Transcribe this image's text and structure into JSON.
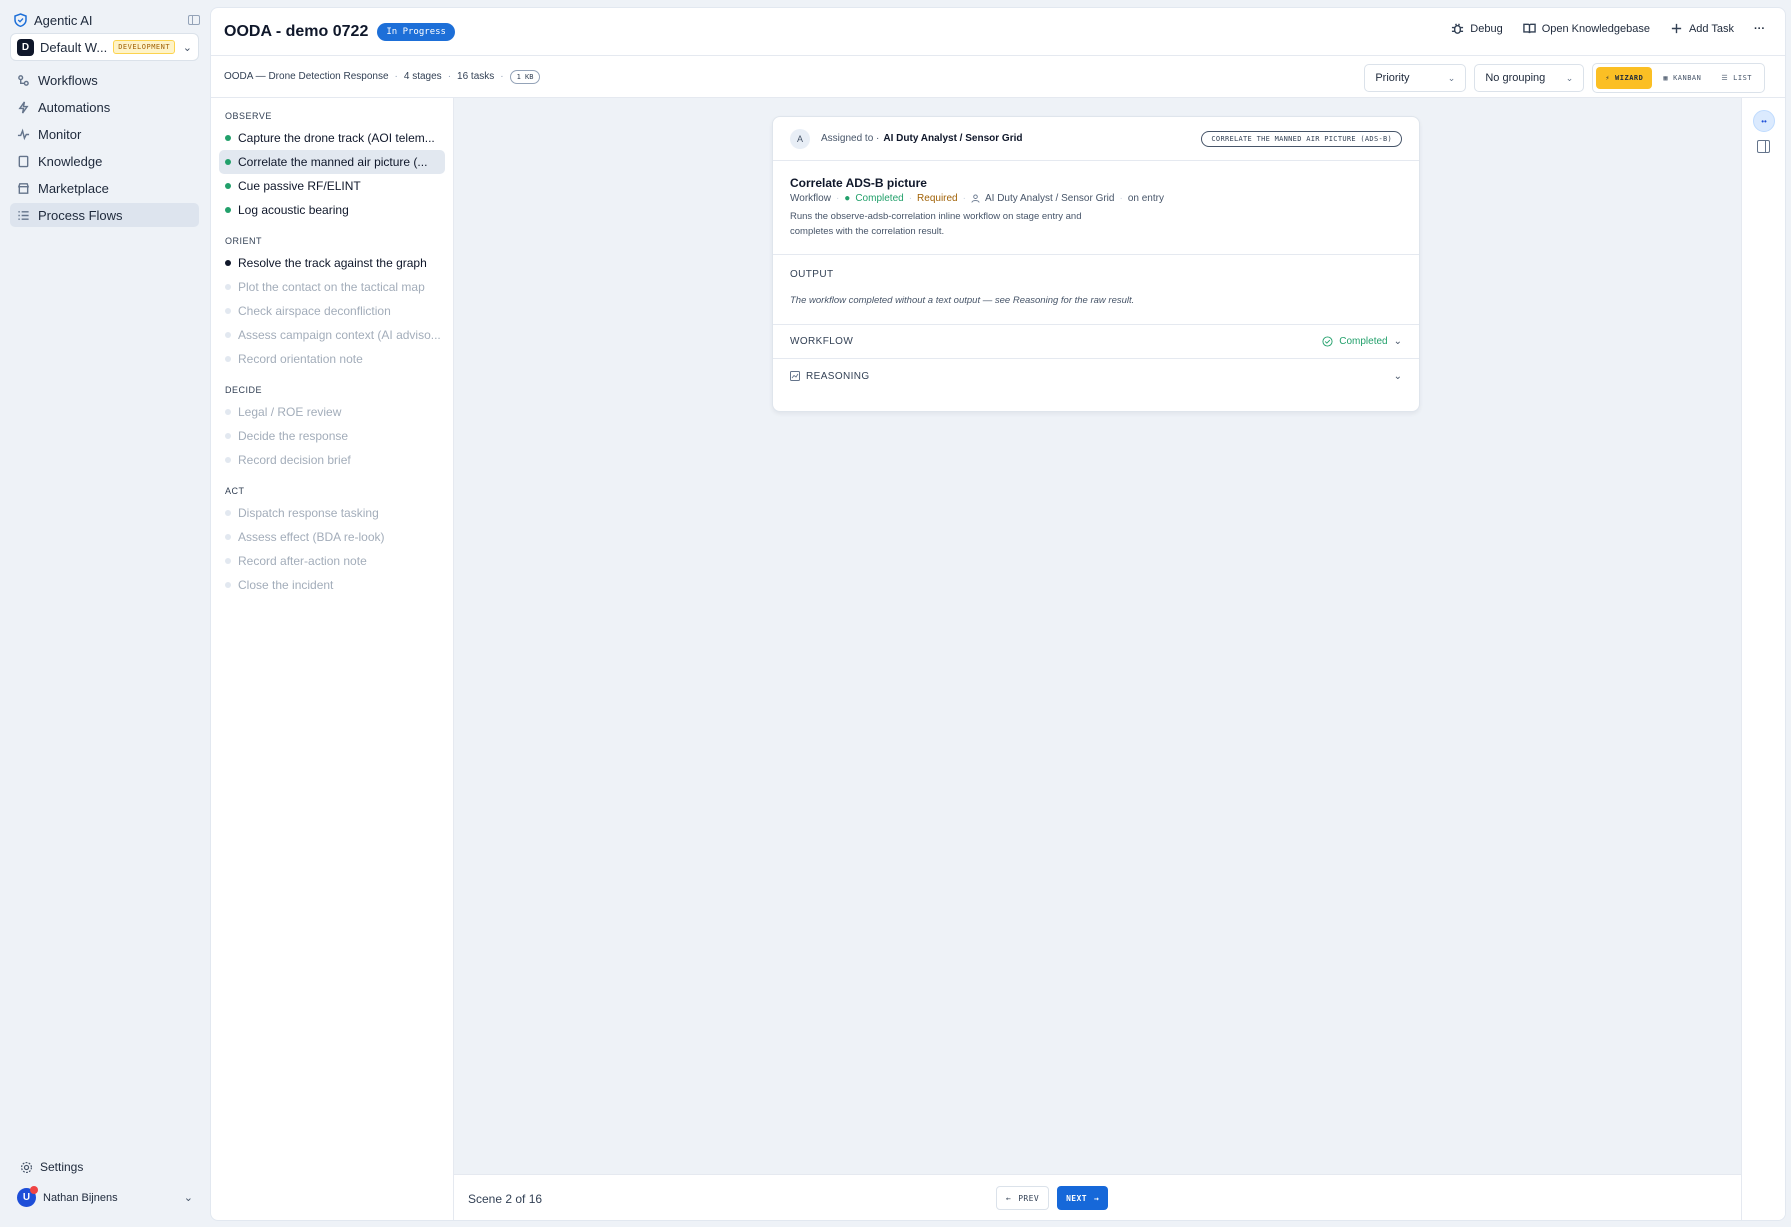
{
  "sidebar": {
    "brand": "Agentic AI",
    "workspace": {
      "initial": "D",
      "name": "Default W...",
      "env_badge": "DEVELOPMENT"
    },
    "nav": [
      {
        "label": "Workflows",
        "icon": "workflows-icon"
      },
      {
        "label": "Automations",
        "icon": "bolt-icon"
      },
      {
        "label": "Monitor",
        "icon": "activity-icon"
      },
      {
        "label": "Knowledge",
        "icon": "book-icon"
      },
      {
        "label": "Marketplace",
        "icon": "store-icon"
      },
      {
        "label": "Process Flows",
        "icon": "list-icon",
        "active": true
      }
    ],
    "settings_label": "Settings",
    "user": {
      "initial": "U",
      "name": "Nathan Bijnens"
    }
  },
  "header": {
    "title": "OODA - demo 0722",
    "status_badge": "In Progress",
    "actions": {
      "debug": "Debug",
      "knowledgebase": "Open Knowledgebase",
      "add_task": "Add Task",
      "more": "···"
    }
  },
  "subheader": {
    "flow_name": "OODA — Drone Detection Response",
    "stages": "4 stages",
    "tasks": "16 tasks",
    "size": "1 KB",
    "priority_select": "Priority",
    "grouping_select": "No grouping",
    "views": {
      "wizard": "WIZARD",
      "kanban": "KANBAN",
      "list": "LIST"
    }
  },
  "stages": [
    {
      "name": "OBSERVE",
      "tasks": [
        {
          "label": "Capture the drone track (AOI telem...",
          "state": "done"
        },
        {
          "label": "Correlate the manned air picture (...",
          "state": "done",
          "active": true
        },
        {
          "label": "Cue passive RF/ELINT",
          "state": "done"
        },
        {
          "label": "Log acoustic bearing",
          "state": "done"
        }
      ]
    },
    {
      "name": "ORIENT",
      "tasks": [
        {
          "label": "Resolve the track against the graph",
          "state": "current"
        },
        {
          "label": "Plot the contact on the tactical map",
          "state": "pending"
        },
        {
          "label": "Check airspace deconfliction",
          "state": "pending"
        },
        {
          "label": "Assess campaign context (AI adviso...",
          "state": "pending"
        },
        {
          "label": "Record orientation note",
          "state": "pending"
        }
      ]
    },
    {
      "name": "DECIDE",
      "tasks": [
        {
          "label": "Legal / ROE review",
          "state": "pending"
        },
        {
          "label": "Decide the response",
          "state": "pending"
        },
        {
          "label": "Record decision brief",
          "state": "pending"
        }
      ]
    },
    {
      "name": "ACT",
      "tasks": [
        {
          "label": "Dispatch response tasking",
          "state": "pending"
        },
        {
          "label": "Assess effect (BDA re-look)",
          "state": "pending"
        },
        {
          "label": "Record after-action note",
          "state": "pending"
        },
        {
          "label": "Close the incident",
          "state": "pending"
        }
      ]
    }
  ],
  "card": {
    "assignee_initial": "A",
    "assigned_prefix": "Assigned to ·",
    "assignee": "AI Duty Analyst / Sensor Grid",
    "tag": "CORRELATE THE MANNED AIR PICTURE (ADS-B)",
    "title": "Correlate ADS-B picture",
    "meta": {
      "type": "Workflow",
      "status": "Completed",
      "required": "Required",
      "owner": "AI Duty Analyst / Sensor Grid",
      "trigger": "on entry"
    },
    "description": "Runs the observe-adsb-correlation inline workflow on stage entry and completes with the correlation result.",
    "output_label": "OUTPUT",
    "output_note": "The workflow completed without a text output — see Reasoning for the raw result.",
    "workflow_label": "WORKFLOW",
    "workflow_status": "Completed",
    "reasoning_label": "REASONING"
  },
  "footer": {
    "scene": "Scene 2 of 16",
    "prev": "PREV",
    "next": "NEXT"
  },
  "colors": {
    "accent": "#1d6fd8",
    "success": "#22a06b",
    "wizard": "#fbbf24"
  }
}
